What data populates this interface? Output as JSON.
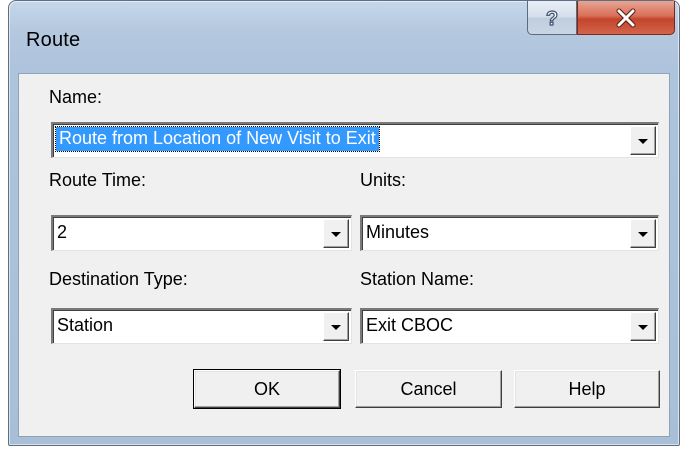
{
  "window": {
    "title": "Route",
    "help_button_glyph": "?",
    "close_button_glyph": "X"
  },
  "form": {
    "name_label": "Name:",
    "name_value": "Route from Location of New Visit to Exit",
    "route_time_label": "Route Time:",
    "route_time_value": "2",
    "units_label": "Units:",
    "units_value": "Minutes",
    "destination_type_label": "Destination Type:",
    "destination_type_value": "Station",
    "station_name_label": "Station Name:",
    "station_name_value": "Exit CBOC"
  },
  "buttons": {
    "ok_label": "OK",
    "cancel_label": "Cancel",
    "help_label": "Help"
  }
}
